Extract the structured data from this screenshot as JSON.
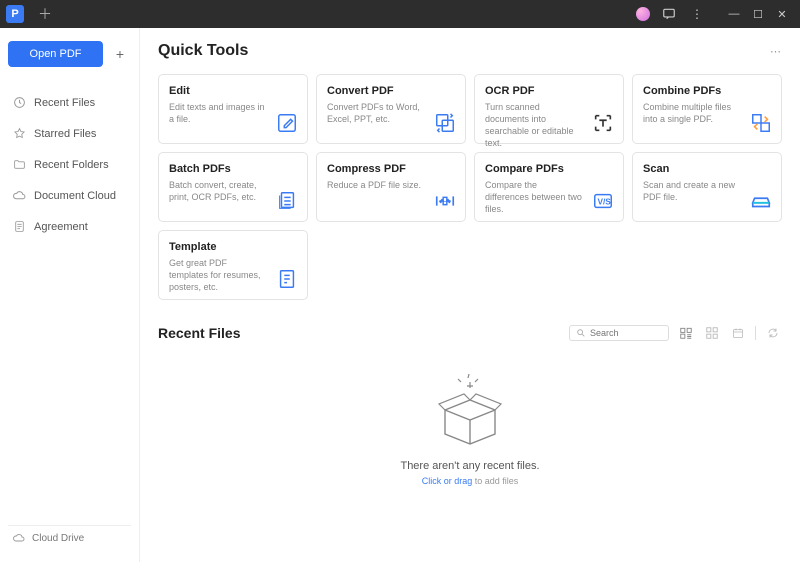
{
  "titlebar": {
    "app_letter": "P"
  },
  "sidebar": {
    "open_label": "Open PDF",
    "items": [
      {
        "icon": "clock-icon",
        "label": "Recent Files"
      },
      {
        "icon": "star-icon",
        "label": "Starred Files"
      },
      {
        "icon": "folder-icon",
        "label": "Recent Folders"
      },
      {
        "icon": "cloud-icon",
        "label": "Document Cloud"
      },
      {
        "icon": "agreement-icon",
        "label": "Agreement"
      }
    ],
    "cloud_drive": "Cloud Drive"
  },
  "quick_tools": {
    "title": "Quick Tools",
    "cards": [
      {
        "title": "Edit",
        "desc": "Edit texts and images in a file.",
        "icon": "edit-icon",
        "color": "#3a7bf4"
      },
      {
        "title": "Convert PDF",
        "desc": "Convert PDFs to Word, Excel, PPT, etc.",
        "icon": "convert-icon",
        "color": "#3a7bf4"
      },
      {
        "title": "OCR PDF",
        "desc": "Turn scanned documents into searchable or editable text.",
        "icon": "ocr-icon",
        "color": "#222"
      },
      {
        "title": "Combine PDFs",
        "desc": "Combine multiple files into a single PDF.",
        "icon": "combine-icon",
        "color": "#3a7bf4"
      },
      {
        "title": "Batch PDFs",
        "desc": "Batch convert, create, print, OCR PDFs, etc.",
        "icon": "batch-icon",
        "color": "#3a7bf4"
      },
      {
        "title": "Compress PDF",
        "desc": "Reduce a PDF file size.",
        "icon": "compress-icon",
        "color": "#3a7bf4"
      },
      {
        "title": "Compare PDFs",
        "desc": "Compare the differences between two files.",
        "icon": "compare-icon",
        "color": "#3a7bf4"
      },
      {
        "title": "Scan",
        "desc": "Scan and create a new PDF file.",
        "icon": "scan-icon",
        "color": "#3a7bf4"
      },
      {
        "title": "Template",
        "desc": "Get great PDF templates for resumes, posters, etc.",
        "icon": "template-icon",
        "color": "#3a7bf4"
      }
    ]
  },
  "recent_files": {
    "title": "Recent Files",
    "search_placeholder": "Search",
    "empty_title": "There aren't any recent files.",
    "empty_action": "Click or drag",
    "empty_rest": " to add files"
  }
}
